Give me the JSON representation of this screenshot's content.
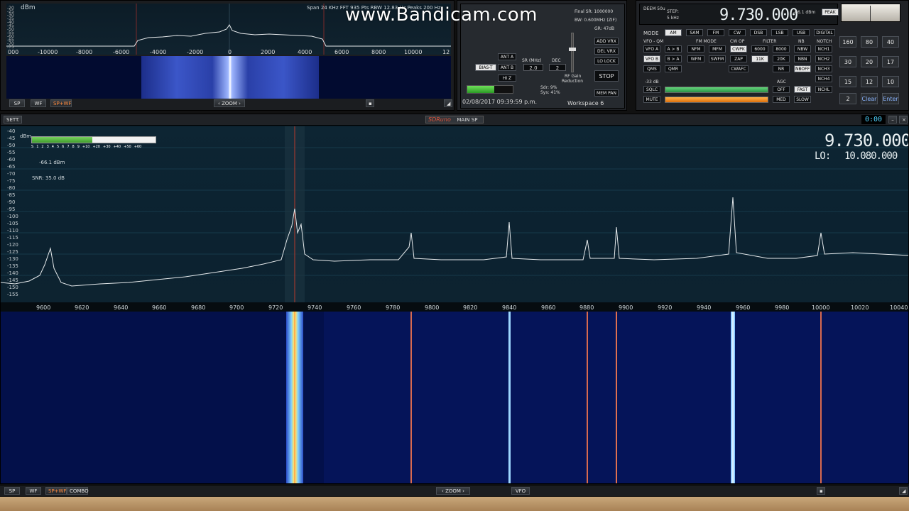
{
  "watermark": "www.Bandicam.com",
  "aux_sp": {
    "unit": "dBm",
    "info": "Span 24 KHz   FFT 935 Pts   RBW 12.83 Hz    Peaks 200 Hz",
    "db_ticks": [
      "-20",
      "-25",
      "-30",
      "-35",
      "-40",
      "-45",
      "-50",
      "-55",
      "-60",
      "-65",
      "-70",
      "-75"
    ],
    "freq_ticks": [
      "000",
      "-10000",
      "-8000",
      "-6000",
      "-4000",
      "-2000",
      "0",
      "2000",
      "4000",
      "6000",
      "8000",
      "10000",
      "12"
    ],
    "buttons": {
      "sp": "SP",
      "wf": "WF",
      "spwf": "SP+WF"
    },
    "zoom": "ZOOM"
  },
  "control": {
    "final_sr": "Final SR: 1000000",
    "bw": "BW: 0.600MHz (ZIF)",
    "gr": "GR: 47dB",
    "ant_a": "ANT A",
    "ant_b": "ANT B",
    "bias_t": "BIAS-T",
    "hiz": "HI Z",
    "sr_label": "SR (MHz)",
    "sr_value": "2.0",
    "dec_label": "DEC",
    "dec_value": "2",
    "rf_gain": "RF Gain",
    "reduction": "Reduction",
    "add_vrx": "ADD VRX",
    "del_vrx": "DEL VRX",
    "lo_lock": "LO LOCK",
    "stop": "STOP",
    "mem_pan": "MEM PAN",
    "sdr": "Sdr: 9%",
    "sys": "Sys: 41%",
    "datetime": "02/08/2017 09:39:59 p.m.",
    "workspace": "Workspace 6"
  },
  "rx": {
    "deem": "DEEM 50u",
    "step_label": "STEP:",
    "step_value": "5 kHz",
    "frequency": "9.730.000",
    "level": "-66.1 dBm",
    "peak": "PEAK",
    "mode_label": "MODE",
    "modes": [
      "AM",
      "SAM",
      "FM",
      "CW",
      "DSB",
      "LSB",
      "USB",
      "DIGITAL"
    ],
    "vfo_qm": "VFO - QM",
    "fm_mode": "FM MODE",
    "cw_op": "CW OP",
    "filter": "FILTER",
    "nb": "NB",
    "notch": "NOTCH",
    "vfo_a": "VFO A",
    "a_b": "A > B",
    "nfm": "NFM",
    "mfm": "MFM",
    "cwpk": "CWPK",
    "f6000": "6000",
    "f8000": "8000",
    "nbw": "NBW",
    "nch1": "NCH1",
    "vfo_b": "VFO B",
    "b_a": "B > A",
    "wfm": "WFM",
    "swfm": "SWFM",
    "zap": "ZAP",
    "f11k": "11K",
    "f20k": "20K",
    "nbn": "NBN",
    "nch2": "NCH2",
    "qms": "QMS",
    "qmr": "QMR",
    "cwafc": "CWAFC",
    "nr": "NR",
    "nboff": "NBOFF",
    "nch3": "NCH3",
    "nch4": "NCH4",
    "agc": "AGC",
    "sql_db": "-33 dB",
    "sqlc": "SQLC",
    "off": "OFF",
    "fast": "FAST",
    "nchl": "NCHL",
    "mute": "MUTE",
    "med": "MED",
    "slow": "SLOW",
    "bands": [
      "160",
      "80",
      "40",
      "30",
      "20",
      "17",
      "15",
      "12",
      "10",
      "2"
    ],
    "clear": "Clear",
    "enter": "Enter"
  },
  "main_sp": {
    "sett": "SETT.",
    "brand": "SDRuno",
    "title": "MAIN SP",
    "clock": "0:00",
    "unit": "dBm",
    "db_ticks": [
      "-40",
      "-45",
      "-50",
      "-55",
      "-60",
      "-65",
      "-70",
      "-75",
      "-80",
      "-85",
      "-90",
      "-95",
      "-100",
      "-105",
      "-110",
      "-115",
      "-120",
      "-125",
      "-130",
      "-135",
      "-140",
      "-145",
      "-150",
      "-155"
    ],
    "smeter_scale": [
      "S",
      "1",
      "2",
      "3",
      "4",
      "5",
      "6",
      "7",
      "8",
      "9",
      "+10",
      "+20",
      "+30",
      "+40",
      "+50",
      "+60"
    ],
    "level": "-66.1 dBm",
    "snr": "SNR: 35.0 dB",
    "frequency": "9.730.000",
    "lo_label": "LO:",
    "lo_value": "10.080.000",
    "freq_ticks": [
      "9600",
      "9620",
      "9640",
      "9660",
      "9680",
      "9700",
      "9720",
      "9740",
      "9760",
      "9780",
      "9800",
      "9820",
      "9840",
      "9860",
      "9880",
      "9900",
      "9920",
      "9940",
      "9960",
      "9980",
      "10000",
      "10020",
      "10040"
    ],
    "buttons": {
      "sp": "SP",
      "wf": "WF",
      "spwf": "SP+WF",
      "combo": "COMBO"
    },
    "zoom": "ZOOM",
    "vfo": "VFO"
  }
}
